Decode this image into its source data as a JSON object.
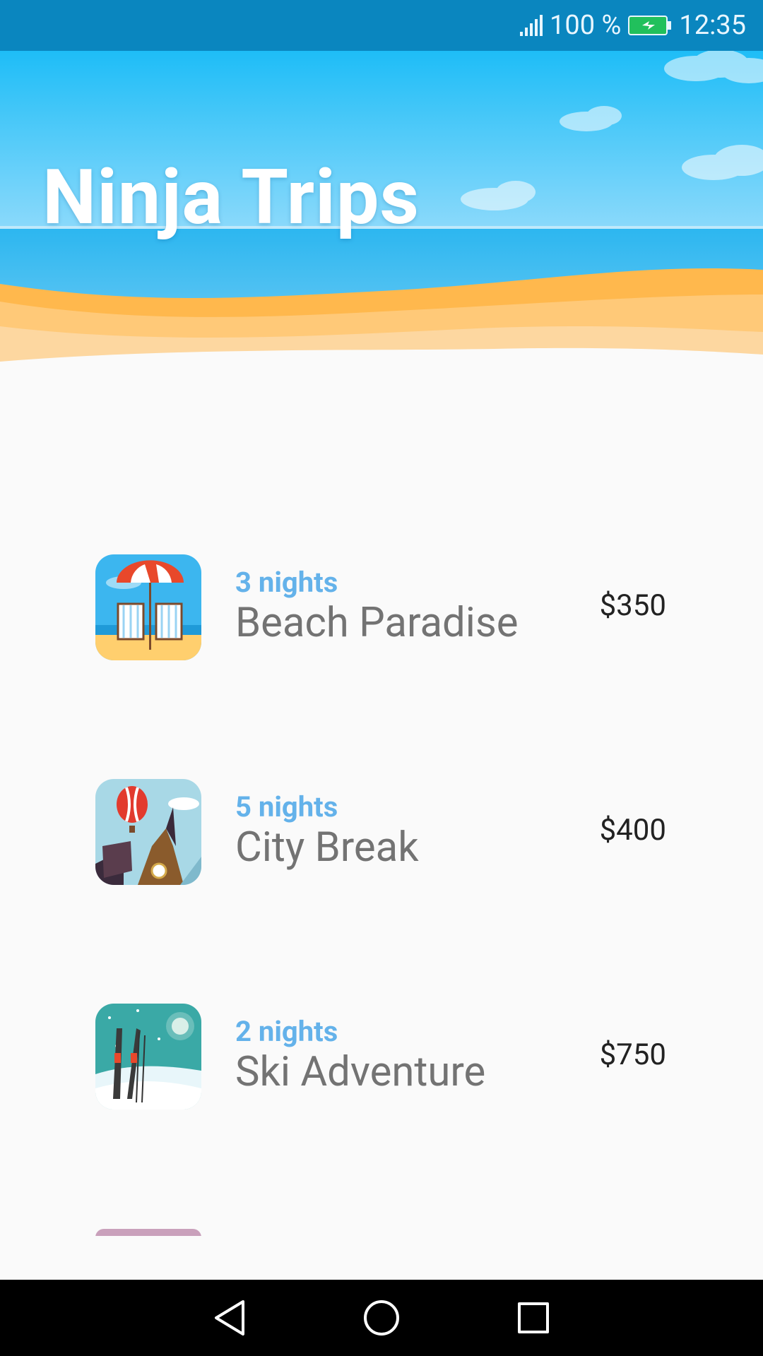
{
  "status_bar": {
    "battery_percent": "100 %",
    "time": "12:35"
  },
  "header": {
    "title": "Ninja Trips"
  },
  "trips": [
    {
      "nights": "3 nights",
      "title": "Beach Paradise",
      "price": "$350",
      "image_icon": "beach-chairs-umbrella-icon"
    },
    {
      "nights": "5 nights",
      "title": "City Break",
      "price": "$400",
      "image_icon": "city-balloon-clocktower-icon"
    },
    {
      "nights": "2 nights",
      "title": "Ski Adventure",
      "price": "$750",
      "image_icon": "skis-snow-icon"
    }
  ],
  "nav_bar": {
    "back_icon": "back-triangle-icon",
    "home_icon": "home-circle-icon",
    "recents_icon": "recents-square-icon"
  },
  "colors": {
    "status_bar": "#0a86bf",
    "nights_accent": "#64b2ea",
    "background": "#fafafa"
  }
}
